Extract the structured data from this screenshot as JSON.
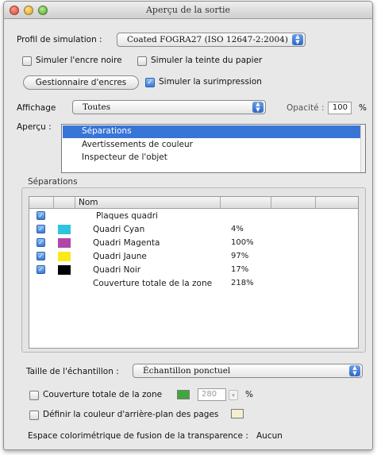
{
  "window": {
    "title": "Aperçu de la sortie"
  },
  "colors": {
    "cyan": "#2ec4dc",
    "magenta": "#b046a8",
    "jaune": "#fbe91c",
    "noir": "#000000",
    "green": "#3fa83c",
    "cream": "#f5efcf",
    "selection": "#3875d7"
  },
  "profil": {
    "label": "Profil de simulation :",
    "value": "Coated FOGRA27 (ISO 12647-2:2004)"
  },
  "options": {
    "encre_noire": "Simuler l'encre noire",
    "teinte_papier": "Simuler la teinte du papier",
    "gestionnaire": "Gestionnaire d'encres",
    "surimpression": "Simuler la surimpression"
  },
  "affichage": {
    "label": "Affichage",
    "value": "Toutes",
    "opacite_label": "Opacité :",
    "opacite_value": "100",
    "percent": "%"
  },
  "apercu": {
    "label": "Aperçu :",
    "items": [
      "Séparations",
      "Avertissements de couleur",
      "Inspecteur de l'objet"
    ]
  },
  "separations": {
    "group_label": "Séparations",
    "column_name": "Nom",
    "rows": [
      {
        "checked": true,
        "name": "Plaques quadri",
        "value": ""
      },
      {
        "checked": true,
        "name": "Quadri Cyan",
        "value": "4%"
      },
      {
        "checked": true,
        "name": "Quadri Magenta",
        "value": "100%"
      },
      {
        "checked": true,
        "name": "Quadri Jaune",
        "value": "97%"
      },
      {
        "checked": true,
        "name": "Quadri Noir",
        "value": "17%"
      },
      {
        "checked": false,
        "name": "Couverture totale de la zone",
        "value": "218%"
      }
    ]
  },
  "echantillon": {
    "label": "Taille de l'échantillon :",
    "value": "Échantillon ponctuel"
  },
  "couverture": {
    "label": "Couverture totale de la zone",
    "value": "280",
    "percent": "%"
  },
  "arriere_plan": {
    "label": "Définir la couleur d'arrière-plan des pages"
  },
  "fusion": {
    "label": "Espace colorimétrique de fusion de la transparence :",
    "value": "Aucun"
  }
}
